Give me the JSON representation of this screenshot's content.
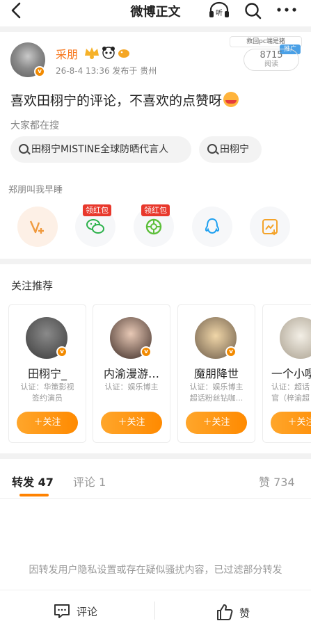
{
  "nav": {
    "title": "微博正文",
    "listen_label": "听"
  },
  "author": {
    "name": "采朋",
    "meta": "26-8-4 13:36  发布于 贵州",
    "sticker_text": "救回pc端是猪",
    "promo_tag": "推广",
    "read_count": "8715",
    "read_label": "阅读"
  },
  "post": {
    "text": "喜欢田栩宁的评论，不喜欢的点赞呀"
  },
  "search": {
    "label": "大家都在搜",
    "chips": [
      "田栩宁MISTINE全球防晒代言人",
      "田栩宁"
    ]
  },
  "share": {
    "label": "郑朋叫我早睡",
    "red_tag": "领红包"
  },
  "recommend": {
    "title": "关注推荐",
    "follow_label": "＋关注",
    "cards": [
      {
        "name": "田栩宁_",
        "cert": "认证：华策影视\n签约演员"
      },
      {
        "name": "内渝漫游…",
        "cert": "认证：娱乐博主"
      },
      {
        "name": "魔朋降世",
        "cert": "认证：娱乐博主\n超话粉丝钻咖..."
      },
      {
        "name": "一个小嘤",
        "cert": "认证：超话\n官（梓渝超"
      }
    ]
  },
  "tabs": {
    "repost": "转发 47",
    "comment": "评论 1",
    "like": "赞 734"
  },
  "filter_note": "因转发用户隐私设置或存在疑似骚扰内容，已过滤部分转发",
  "bottom_bar": {
    "comment": "评论",
    "like": "赞"
  },
  "colors": {
    "accent": "#ff8200",
    "author_name": "#f7771d",
    "red_tag": "#e8382c"
  }
}
